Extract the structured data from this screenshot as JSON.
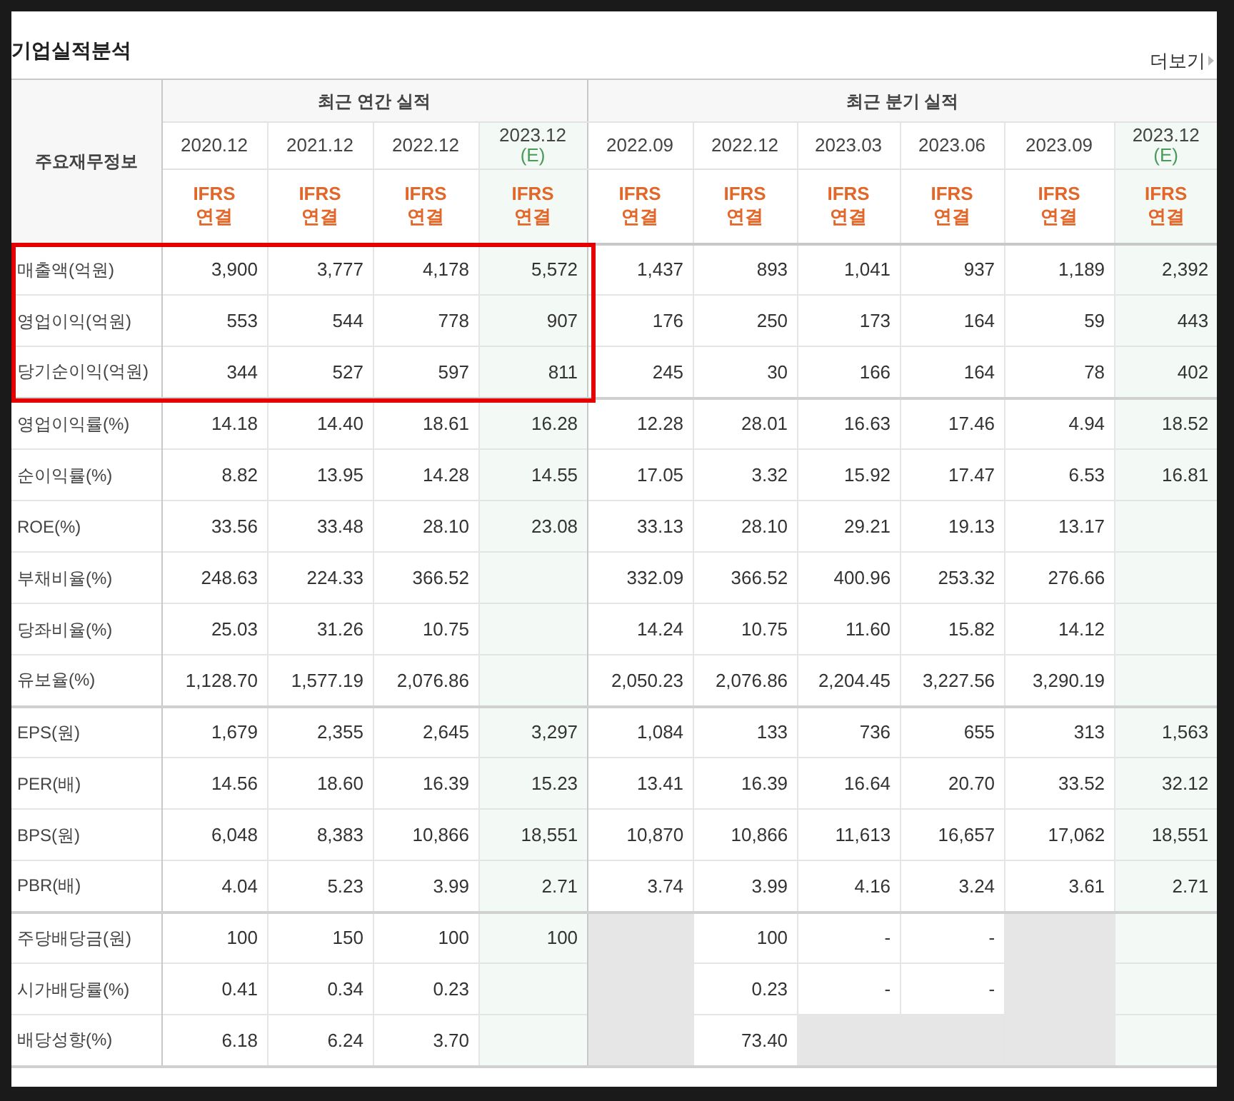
{
  "title": "기업실적분석",
  "more_link": "더보기",
  "header": {
    "row_label": "주요재무정보",
    "groups": [
      {
        "label": "최근 연간 실적",
        "columns": [
          {
            "period": "2020.12",
            "estimate": false,
            "basis": [
              "IFRS",
              "연결"
            ]
          },
          {
            "period": "2021.12",
            "estimate": false,
            "basis": [
              "IFRS",
              "연결"
            ]
          },
          {
            "period": "2022.12",
            "estimate": false,
            "basis": [
              "IFRS",
              "연결"
            ]
          },
          {
            "period": "2023.12",
            "estimate": true,
            "estimate_label": "(E)",
            "basis": [
              "IFRS",
              "연결"
            ]
          }
        ]
      },
      {
        "label": "최근 분기 실적",
        "columns": [
          {
            "period": "2022.09",
            "estimate": false,
            "basis": [
              "IFRS",
              "연결"
            ]
          },
          {
            "period": "2022.12",
            "estimate": false,
            "basis": [
              "IFRS",
              "연결"
            ]
          },
          {
            "period": "2023.03",
            "estimate": false,
            "basis": [
              "IFRS",
              "연결"
            ]
          },
          {
            "period": "2023.06",
            "estimate": false,
            "basis": [
              "IFRS",
              "연결"
            ]
          },
          {
            "period": "2023.09",
            "estimate": false,
            "basis": [
              "IFRS",
              "연결"
            ]
          },
          {
            "period": "2023.12",
            "estimate": true,
            "estimate_label": "(E)",
            "basis": [
              "IFRS",
              "연결"
            ]
          }
        ]
      }
    ]
  },
  "row_groups": [
    {
      "highlighted": true,
      "rows": [
        {
          "label": "매출액(억원)",
          "cells": [
            "3,900",
            "3,777",
            "4,178",
            "5,572",
            "1,437",
            "893",
            "1,041",
            "937",
            "1,189",
            "2,392"
          ]
        },
        {
          "label": "영업이익(억원)",
          "cells": [
            "553",
            "544",
            "778",
            "907",
            "176",
            "250",
            "173",
            "164",
            "59",
            "443"
          ]
        },
        {
          "label": "당기순이익(억원)",
          "cells": [
            "344",
            "527",
            "597",
            "811",
            "245",
            "30",
            "166",
            "164",
            "78",
            "402"
          ]
        }
      ]
    },
    {
      "highlighted": false,
      "rows": [
        {
          "label": "영업이익률(%)",
          "cells": [
            "14.18",
            "14.40",
            "18.61",
            "16.28",
            "12.28",
            "28.01",
            "16.63",
            "17.46",
            "4.94",
            "18.52"
          ]
        },
        {
          "label": "순이익률(%)",
          "cells": [
            "8.82",
            "13.95",
            "14.28",
            "14.55",
            "17.05",
            "3.32",
            "15.92",
            "17.47",
            "6.53",
            "16.81"
          ]
        },
        {
          "label": "ROE(%)",
          "cells": [
            "33.56",
            "33.48",
            "28.10",
            "23.08",
            "33.13",
            "28.10",
            "29.21",
            "19.13",
            "13.17",
            {
              "unavailable": false
            }
          ]
        },
        {
          "label": "부채비율(%)",
          "cells": [
            "248.63",
            "224.33",
            "366.52",
            {
              "unavailable": false
            },
            "332.09",
            "366.52",
            "400.96",
            "253.32",
            "276.66",
            {
              "unavailable": false
            }
          ]
        },
        {
          "label": "당좌비율(%)",
          "cells": [
            "25.03",
            "31.26",
            "10.75",
            {
              "unavailable": false
            },
            "14.24",
            "10.75",
            "11.60",
            "15.82",
            "14.12",
            {
              "unavailable": false
            }
          ]
        },
        {
          "label": "유보율(%)",
          "cells": [
            "1,128.70",
            "1,577.19",
            "2,076.86",
            {
              "unavailable": false
            },
            "2,050.23",
            "2,076.86",
            "2,204.45",
            "3,227.56",
            "3,290.19",
            {
              "unavailable": false
            }
          ]
        }
      ]
    },
    {
      "highlighted": false,
      "rows": [
        {
          "label": "EPS(원)",
          "cells": [
            "1,679",
            "2,355",
            "2,645",
            "3,297",
            "1,084",
            "133",
            "736",
            "655",
            "313",
            "1,563"
          ]
        },
        {
          "label": "PER(배)",
          "cells": [
            "14.56",
            "18.60",
            "16.39",
            "15.23",
            "13.41",
            "16.39",
            "16.64",
            "20.70",
            "33.52",
            "32.12"
          ]
        },
        {
          "label": "BPS(원)",
          "cells": [
            "6,048",
            "8,383",
            "10,866",
            "18,551",
            "10,870",
            "10,866",
            "11,613",
            "16,657",
            "17,062",
            "18,551"
          ]
        },
        {
          "label": "PBR(배)",
          "cells": [
            "4.04",
            "5.23",
            "3.99",
            "2.71",
            "3.74",
            "3.99",
            "4.16",
            "3.24",
            "3.61",
            "2.71"
          ]
        }
      ]
    },
    {
      "highlighted": false,
      "rows": [
        {
          "label": "주당배당금(원)",
          "cells": [
            "100",
            "150",
            "100",
            "100",
            {
              "unavailable": true
            },
            "100",
            "-",
            "-",
            {
              "unavailable": true
            },
            {
              "unavailable": false
            }
          ]
        },
        {
          "label": "시가배당률(%)",
          "cells": [
            "0.41",
            "0.34",
            "0.23",
            {
              "unavailable": false
            },
            {
              "unavailable": true
            },
            "0.23",
            "-",
            "-",
            {
              "unavailable": true
            },
            {
              "unavailable": false
            }
          ]
        },
        {
          "label": "배당성향(%)",
          "cells": [
            "6.18",
            "6.24",
            "3.70",
            {
              "unavailable": false
            },
            {
              "unavailable": true
            },
            "73.40",
            {
              "unavailable": true
            },
            {
              "unavailable": true
            },
            {
              "unavailable": true
            },
            {
              "unavailable": false
            }
          ]
        }
      ]
    }
  ]
}
